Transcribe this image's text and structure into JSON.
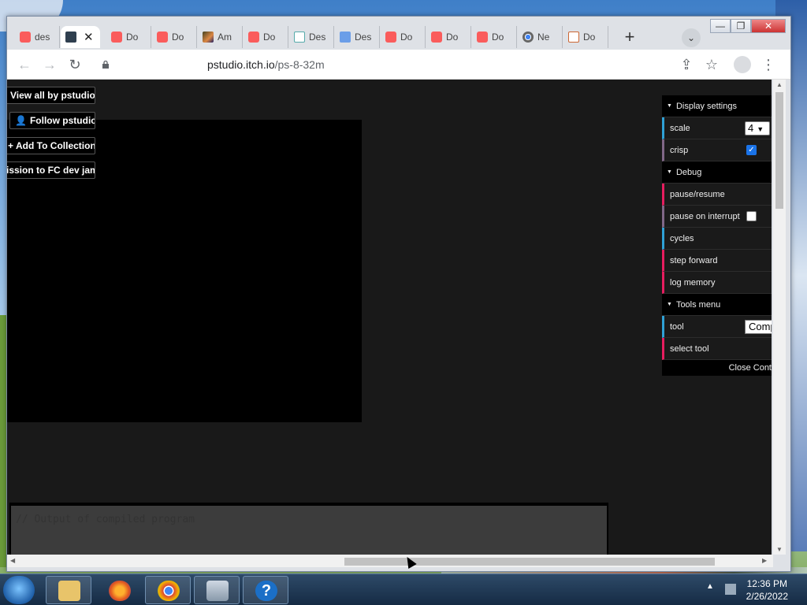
{
  "browser": {
    "tabs": [
      {
        "label": "des",
        "icon": "itch-icon"
      },
      {
        "label": "",
        "icon": "dark-square-icon",
        "active": true
      },
      {
        "label": "Do",
        "icon": "itch-icon"
      },
      {
        "label": "Do",
        "icon": "itch-icon"
      },
      {
        "label": "Am",
        "icon": "image-icon"
      },
      {
        "label": "Do",
        "icon": "itch-icon"
      },
      {
        "label": "Des",
        "icon": "doc-icon"
      },
      {
        "label": "Des",
        "icon": "blue-doc-icon"
      },
      {
        "label": "Do",
        "icon": "itch-icon"
      },
      {
        "label": "Do",
        "icon": "itch-icon"
      },
      {
        "label": "Do",
        "icon": "itch-icon"
      },
      {
        "label": "Ne",
        "icon": "chrome-icon"
      },
      {
        "label": "Do",
        "icon": "jar-icon"
      }
    ],
    "tab_close_glyph": "✕",
    "new_tab_glyph": "+",
    "tab_search_glyph": "⌄",
    "url_host": "pstudio.itch.io",
    "url_path": "/ps-8-32m",
    "back_glyph": "←",
    "forward_glyph": "→",
    "reload_glyph": "↻",
    "share_glyph": "⇪",
    "star_glyph": "☆",
    "menu_glyph": "⋮",
    "window_controls": {
      "minimize": "—",
      "maximize": "❐",
      "close": "✕"
    }
  },
  "itch_bar": {
    "view_all": "View all by pstudio",
    "follow": "Follow pstudio",
    "add_to_collection": "Add To Collection",
    "submission": "ission to FC dev jam"
  },
  "gui": {
    "display_settings": {
      "title": "Display settings",
      "scale_label": "scale",
      "scale_value": "4",
      "crisp_label": "crisp",
      "crisp_checked": true
    },
    "debug": {
      "title": "Debug",
      "pause_resume": "pause/resume",
      "pause_on_interrupt": "pause on interrupt",
      "pause_on_interrupt_checked": false,
      "cycles": "cycles",
      "step_forward": "step forward",
      "log_memory": "log memory"
    },
    "tools_menu": {
      "title": "Tools menu",
      "tool_label": "tool",
      "tool_value": "Comp",
      "select_tool": "select tool"
    },
    "close_controls": "Close Cont"
  },
  "output_placeholder": "// Output of compiled program",
  "taskbar": {
    "clock_time": "12:36 PM",
    "clock_date": "2/26/2022",
    "apps": [
      "explorer-icon",
      "firefox-icon",
      "chrome-icon",
      "system-monitor-icon",
      "help-icon"
    ],
    "help_glyph": "?"
  },
  "colors": {
    "page_bg": "#191919",
    "gui_number": "#2fa1d6",
    "gui_function": "#e61d5f",
    "itch_red": "#fa5c5c",
    "checkbox_blue": "#1a73e8"
  }
}
